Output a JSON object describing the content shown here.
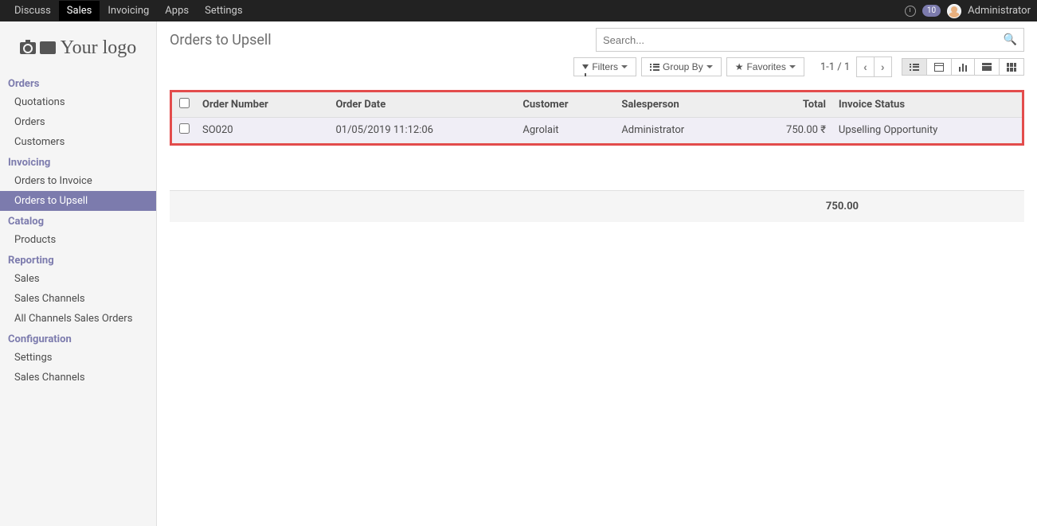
{
  "topnav": {
    "items": [
      "Discuss",
      "Sales",
      "Invoicing",
      "Apps",
      "Settings"
    ],
    "active": 1,
    "badge": "10",
    "username": "Administrator"
  },
  "logo": "Your logo",
  "sidebar": {
    "sections": [
      {
        "header": "Orders",
        "items": [
          "Quotations",
          "Orders",
          "Customers"
        ],
        "active": null
      },
      {
        "header": "Invoicing",
        "items": [
          "Orders to Invoice",
          "Orders to Upsell"
        ],
        "active": 1
      },
      {
        "header": "Catalog",
        "items": [
          "Products"
        ],
        "active": null
      },
      {
        "header": "Reporting",
        "items": [
          "Sales",
          "Sales Channels",
          "All Channels Sales Orders"
        ],
        "active": null
      },
      {
        "header": "Configuration",
        "items": [
          "Settings",
          "Sales Channels"
        ],
        "active": null
      }
    ]
  },
  "page": {
    "title": "Orders to Upsell",
    "search_placeholder": "Search...",
    "filters_label": "Filters",
    "groupby_label": "Group By",
    "favorites_label": "Favorites",
    "pager": "1-1 / 1"
  },
  "table": {
    "columns": [
      "Order Number",
      "Order Date",
      "Customer",
      "Salesperson",
      "Total",
      "Invoice Status"
    ],
    "rows": [
      {
        "order_number": "SO020",
        "order_date": "01/05/2019 11:12:06",
        "customer": "Agrolait",
        "salesperson": "Administrator",
        "total": "750.00 ₹",
        "invoice_status": "Upselling Opportunity"
      }
    ],
    "footer_total": "750.00"
  }
}
